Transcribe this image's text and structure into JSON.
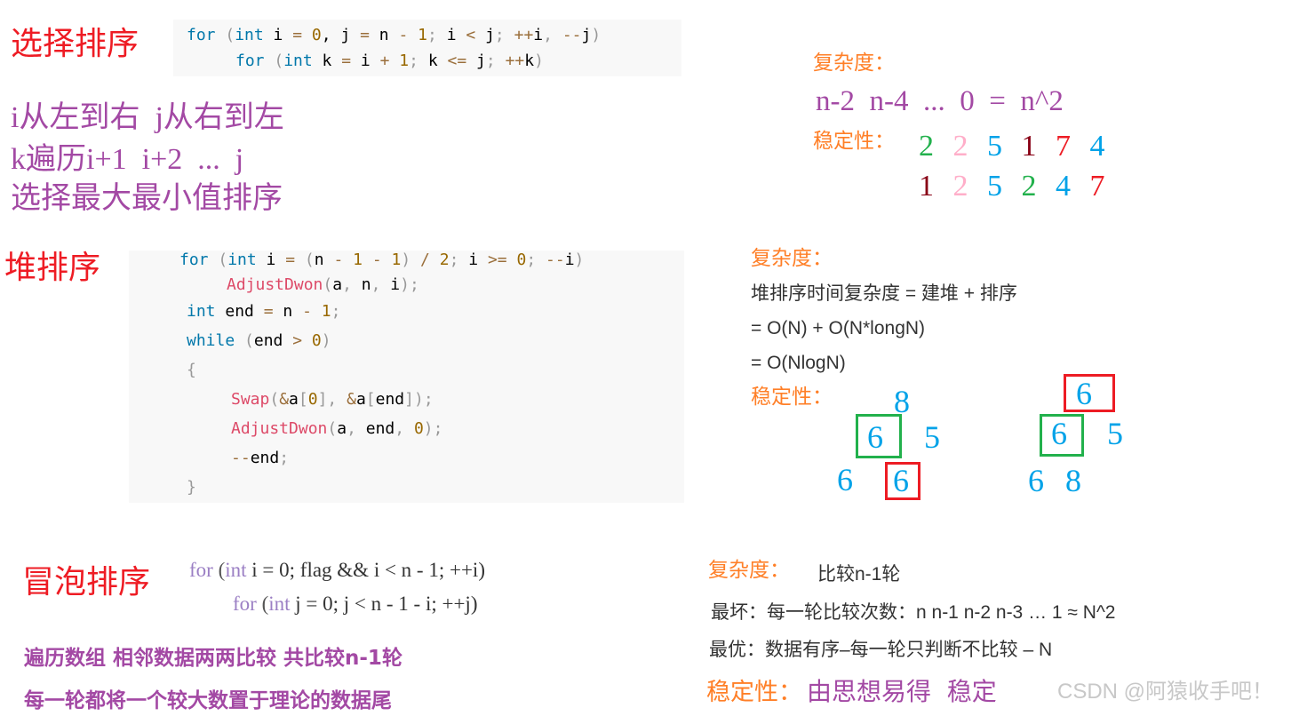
{
  "colors": {
    "heading": "#ee1c24",
    "purple": "#a349a4",
    "orange": "#ff7f27",
    "blue": "#00a2e8",
    "green": "#22b14c",
    "pink": "#ffaec9",
    "darkred": "#880015",
    "red": "#ed1c24"
  },
  "selection": {
    "title": "选择排序",
    "code": [
      [
        [
          "for",
          "kw"
        ],
        [
          " (",
          "pu"
        ],
        [
          "int",
          "kw"
        ],
        [
          " i ",
          "id"
        ],
        [
          "=",
          "op"
        ],
        [
          " ",
          "id"
        ],
        [
          "0",
          "num"
        ],
        [
          ", j ",
          "id"
        ],
        [
          "=",
          "op"
        ],
        [
          " n ",
          "id"
        ],
        [
          "-",
          "op"
        ],
        [
          " ",
          "id"
        ],
        [
          "1",
          "num"
        ],
        [
          "; ",
          "pu"
        ],
        [
          "i ",
          "id"
        ],
        [
          "<",
          "op"
        ],
        [
          " j",
          "id"
        ],
        [
          "; ",
          "pu"
        ],
        [
          "++",
          "op"
        ],
        [
          "i",
          ""
        ],
        [
          ", ",
          "pu"
        ],
        [
          "--",
          "op"
        ],
        [
          "j",
          "id"
        ],
        [
          ")",
          "pu"
        ]
      ],
      [
        [
          "for",
          "kw"
        ],
        [
          " (",
          "pu"
        ],
        [
          "int",
          "kw"
        ],
        [
          " k ",
          "id"
        ],
        [
          "=",
          "op"
        ],
        [
          " i ",
          "id"
        ],
        [
          "+",
          "op"
        ],
        [
          " ",
          "id"
        ],
        [
          "1",
          "num"
        ],
        [
          "; ",
          "pu"
        ],
        [
          "k ",
          "id"
        ],
        [
          "<=",
          "op"
        ],
        [
          " j",
          "id"
        ],
        [
          "; ",
          "pu"
        ],
        [
          "++",
          "op"
        ],
        [
          "k",
          "id"
        ],
        [
          ")",
          "pu"
        ]
      ]
    ],
    "notes": [
      "i从左到右  j从右到左",
      "k遍历i+1  i+2  ...  j",
      "选择最大最小值排序"
    ],
    "complexity_label": "复杂度：",
    "complexity": "n-2  n-4  ...  0  =  n^2",
    "stability_label": "稳定性：",
    "row1": [
      {
        "v": "2",
        "c": "green"
      },
      {
        "v": "2",
        "c": "pink"
      },
      {
        "v": "5",
        "c": "blue"
      },
      {
        "v": "1",
        "c": "darkred"
      },
      {
        "v": "7",
        "c": "red"
      },
      {
        "v": "4",
        "c": "blue"
      }
    ],
    "row2": [
      {
        "v": "1",
        "c": "darkred"
      },
      {
        "v": "2",
        "c": "pink"
      },
      {
        "v": "5",
        "c": "blue"
      },
      {
        "v": "2",
        "c": "green"
      },
      {
        "v": "4",
        "c": "blue"
      },
      {
        "v": "7",
        "c": "red"
      }
    ]
  },
  "heap": {
    "title": "堆排序",
    "code": [
      [
        [
          "for",
          "kw"
        ],
        [
          " (",
          "pu"
        ],
        [
          "int",
          "kw"
        ],
        [
          " i ",
          "id"
        ],
        [
          "=",
          "op"
        ],
        [
          " (",
          "pu"
        ],
        [
          "n ",
          "id"
        ],
        [
          "-",
          "op"
        ],
        [
          " ",
          "id"
        ],
        [
          "1",
          "num"
        ],
        [
          " ",
          "id"
        ],
        [
          "-",
          "op"
        ],
        [
          " ",
          "id"
        ],
        [
          "1",
          "num"
        ],
        [
          ")",
          "pu"
        ],
        [
          " / ",
          "op"
        ],
        [
          "2",
          "num"
        ],
        [
          "; ",
          "pu"
        ],
        [
          "i ",
          "id"
        ],
        [
          ">=",
          "op"
        ],
        [
          " ",
          "id"
        ],
        [
          "0",
          "num"
        ],
        [
          "; ",
          "pu"
        ],
        [
          "--",
          "op"
        ],
        [
          "i",
          "id"
        ],
        [
          ")",
          "pu"
        ]
      ],
      [
        [
          "AdjustDwon",
          "fn"
        ],
        [
          "(",
          "pu"
        ],
        [
          "a",
          ""
        ],
        [
          ", ",
          "pu"
        ],
        [
          "n",
          ""
        ],
        [
          ", ",
          "pu"
        ],
        [
          "i",
          "id"
        ],
        [
          ");",
          "pu"
        ]
      ],
      [
        [
          "int",
          "kw"
        ],
        [
          " end ",
          "id"
        ],
        [
          "=",
          "op"
        ],
        [
          " n ",
          "id"
        ],
        [
          "-",
          "op"
        ],
        [
          " ",
          "id"
        ],
        [
          "1",
          "num"
        ],
        [
          ";",
          "pu"
        ]
      ],
      [
        [
          "while",
          "kw"
        ],
        [
          " (",
          "pu"
        ],
        [
          "end ",
          "id"
        ],
        [
          ">",
          "op"
        ],
        [
          " ",
          "id"
        ],
        [
          "0",
          "num"
        ],
        [
          ")",
          "pu"
        ]
      ],
      [
        [
          "{",
          "pu"
        ]
      ],
      [
        [
          "Swap",
          "fn"
        ],
        [
          "(",
          "pu"
        ],
        [
          "&",
          "op"
        ],
        [
          "a",
          "id"
        ],
        [
          "[",
          "pu"
        ],
        [
          "0",
          "num"
        ],
        [
          "], ",
          "pu"
        ],
        [
          "&",
          "op"
        ],
        [
          "a",
          "id"
        ],
        [
          "[",
          "pu"
        ],
        [
          "end",
          "id"
        ],
        [
          "]);",
          "pu"
        ]
      ],
      [
        [
          "AdjustDwon",
          "fn"
        ],
        [
          "(",
          "pu"
        ],
        [
          "a",
          "id"
        ],
        [
          ", ",
          "pu"
        ],
        [
          "end",
          "id"
        ],
        [
          ", ",
          "pu"
        ],
        [
          "0",
          "num"
        ],
        [
          ");",
          "pu"
        ]
      ],
      [
        [
          "--",
          "op"
        ],
        [
          "end",
          "id"
        ],
        [
          ";",
          "pu"
        ]
      ],
      [
        [
          "}",
          "pu"
        ]
      ]
    ],
    "complexity_label": "复杂度：",
    "complexity_lines": [
      "堆排序时间复杂度 = 建堆 + 排序",
      "= O(N) + O(N*longN)",
      "= O(NlogN)"
    ],
    "stability_label": "稳定性：",
    "tree1": {
      "root": "8",
      "left": "6",
      "right": "5",
      "ll": "6",
      "lr": "6"
    },
    "tree2": {
      "root": "6",
      "left": "6",
      "right": "5",
      "ll": "6",
      "lr": "8"
    }
  },
  "bubble": {
    "title": "冒泡排序",
    "code": [
      [
        [
          "for",
          "kw"
        ],
        [
          " (",
          "pu"
        ],
        [
          "int",
          "kw"
        ],
        [
          " i = 0; flag && i < n - 1; ++i)",
          "id"
        ]
      ],
      [
        [
          "for",
          "kw"
        ],
        [
          " (",
          "pu"
        ],
        [
          "int",
          "kw"
        ],
        [
          " j = 0; j < n - 1 - i; ++j)",
          "id"
        ]
      ]
    ],
    "notes": [
      "遍历数组 相邻数据两两比较 共比较n-1轮",
      "每一轮都将一个较大数置于理论的数据尾"
    ],
    "complexity_label": "复杂度：",
    "complexity": "比较n-1轮",
    "worst": "最坏：每一轮比较次数：n n-1 n-2 n-3 … 1 ≈ N^2",
    "best": "最优：数据有序–每一轮只判断不比较 – N",
    "stability_label": "稳定性：",
    "stability": "由思想易得  稳定"
  },
  "watermark": "CSDN @阿猿收手吧！"
}
